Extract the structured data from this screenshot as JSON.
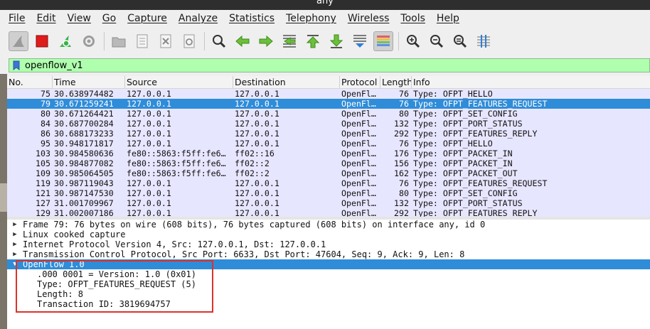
{
  "window": {
    "title": "any"
  },
  "menu": [
    "File",
    "Edit",
    "View",
    "Go",
    "Capture",
    "Analyze",
    "Statistics",
    "Telephony",
    "Wireless",
    "Tools",
    "Help"
  ],
  "colors": {
    "selection": "#2f8cd8",
    "row_bg": "#e7e6ff",
    "filter_bg": "#afffaf",
    "highlight_box": "#d9342b"
  },
  "toolbar": {
    "icons": [
      "shark-fin-icon",
      "stop-capture-icon",
      "restart-capture-icon",
      "capture-options-icon",
      "open-file-icon",
      "save-file-icon",
      "close-file-icon",
      "reload-file-icon",
      "find-packet-icon",
      "go-back-icon",
      "go-forward-icon",
      "go-to-packet-icon",
      "go-first-packet-icon",
      "go-last-packet-icon",
      "auto-scroll-icon",
      "colorize-icon",
      "zoom-in-icon",
      "zoom-out-icon",
      "normal-size-icon",
      "resize-columns-icon"
    ]
  },
  "filter": {
    "value": "openflow_v1"
  },
  "packet_list": {
    "columns": [
      "No.",
      "Time",
      "Source",
      "Destination",
      "Protocol",
      "Length",
      "Info"
    ],
    "rows": [
      {
        "no": "75",
        "time": "30.638974482",
        "src": "127.0.0.1",
        "dst": "127.0.0.1",
        "proto": "OpenFl…",
        "len": "76",
        "info": "Type: OFPT_HELLO",
        "selected": false
      },
      {
        "no": "79",
        "time": "30.671259241",
        "src": "127.0.0.1",
        "dst": "127.0.0.1",
        "proto": "OpenFl…",
        "len": "76",
        "info": "Type: OFPT_FEATURES_REQUEST",
        "selected": true
      },
      {
        "no": "80",
        "time": "30.671264421",
        "src": "127.0.0.1",
        "dst": "127.0.0.1",
        "proto": "OpenFl…",
        "len": "80",
        "info": "Type: OFPT_SET_CONFIG",
        "selected": false
      },
      {
        "no": "84",
        "time": "30.687700284",
        "src": "127.0.0.1",
        "dst": "127.0.0.1",
        "proto": "OpenFl…",
        "len": "132",
        "info": "Type: OFPT_PORT_STATUS",
        "selected": false
      },
      {
        "no": "86",
        "time": "30.688173233",
        "src": "127.0.0.1",
        "dst": "127.0.0.1",
        "proto": "OpenFl…",
        "len": "292",
        "info": "Type: OFPT_FEATURES_REPLY",
        "selected": false
      },
      {
        "no": "95",
        "time": "30.948171817",
        "src": "127.0.0.1",
        "dst": "127.0.0.1",
        "proto": "OpenFl…",
        "len": "76",
        "info": "Type: OFPT_HELLO",
        "selected": false
      },
      {
        "no": "103",
        "time": "30.984580636",
        "src": "fe80::5863:f5ff:fe6…",
        "dst": "ff02::16",
        "proto": "OpenFl…",
        "len": "176",
        "info": "Type: OFPT_PACKET_IN",
        "selected": false
      },
      {
        "no": "105",
        "time": "30.984877082",
        "src": "fe80::5863:f5ff:fe6…",
        "dst": "ff02::2",
        "proto": "OpenFl…",
        "len": "156",
        "info": "Type: OFPT_PACKET_IN",
        "selected": false
      },
      {
        "no": "109",
        "time": "30.985064505",
        "src": "fe80::5863:f5ff:fe6…",
        "dst": "ff02::2",
        "proto": "OpenFl…",
        "len": "162",
        "info": "Type: OFPT_PACKET_OUT",
        "selected": false
      },
      {
        "no": "119",
        "time": "30.987119043",
        "src": "127.0.0.1",
        "dst": "127.0.0.1",
        "proto": "OpenFl…",
        "len": "76",
        "info": "Type: OFPT_FEATURES_REQUEST",
        "selected": false
      },
      {
        "no": "121",
        "time": "30.987147530",
        "src": "127.0.0.1",
        "dst": "127.0.0.1",
        "proto": "OpenFl…",
        "len": "80",
        "info": "Type: OFPT_SET_CONFIG",
        "selected": false
      },
      {
        "no": "127",
        "time": "31.001709967",
        "src": "127.0.0.1",
        "dst": "127.0.0.1",
        "proto": "OpenFl…",
        "len": "132",
        "info": "Type: OFPT_PORT_STATUS",
        "selected": false
      },
      {
        "no": "129",
        "time": "31.002007186",
        "src": "127.0.0.1",
        "dst": "127.0.0.1",
        "proto": "OpenFl…",
        "len": "292",
        "info": "Type: OFPT_FEATURES_REPLY",
        "selected": false
      }
    ]
  },
  "details": {
    "items": [
      {
        "text": "Frame 79: 76 bytes on wire (608 bits), 76 bytes captured (608 bits) on interface any, id 0",
        "expanded": false
      },
      {
        "text": "Linux cooked capture",
        "expanded": false
      },
      {
        "text": "Internet Protocol Version 4, Src: 127.0.0.1, Dst: 127.0.0.1",
        "expanded": false
      },
      {
        "text": "Transmission Control Protocol, Src Port: 6633, Dst Port: 47604, Seq: 9, Ack: 9, Len: 8",
        "expanded": false
      },
      {
        "text": "OpenFlow 1.0",
        "expanded": true,
        "selected": true
      }
    ],
    "openflow_children": [
      ".000 0001 = Version: 1.0 (0x01)",
      "Type: OFPT_FEATURES_REQUEST (5)",
      "Length: 8",
      "Transaction ID: 3819694757"
    ]
  }
}
